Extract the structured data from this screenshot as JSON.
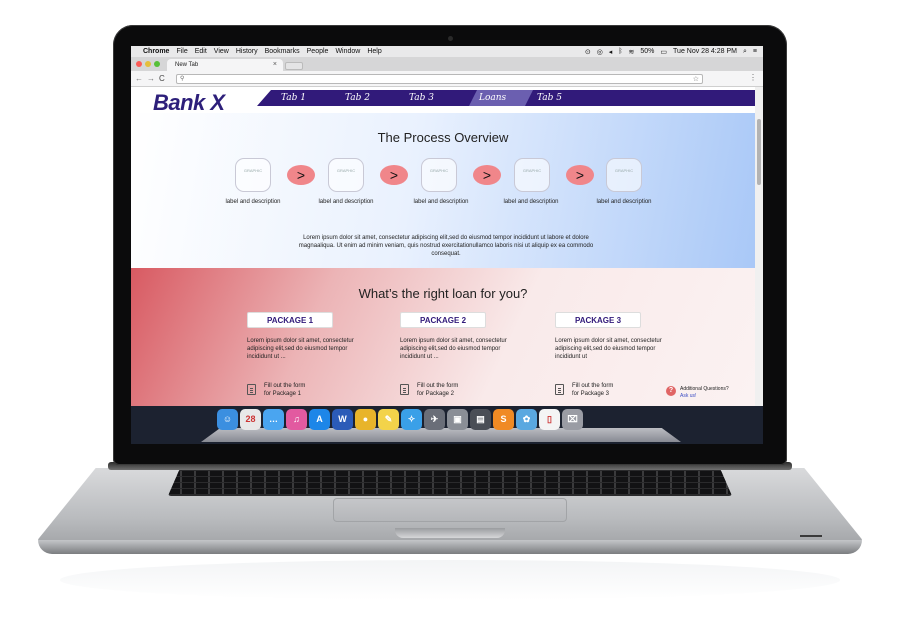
{
  "menubar": {
    "app": "Chrome",
    "items": [
      "File",
      "Edit",
      "View",
      "History",
      "Bookmarks",
      "People",
      "Window",
      "Help"
    ],
    "battery": "50%",
    "clock": "Tue Nov 28  4:28 PM"
  },
  "browser": {
    "tab_title": "New Tab",
    "tab_close": "×",
    "address_value": ""
  },
  "site": {
    "logo": "Bank X",
    "nav": [
      {
        "label": "Tab 1",
        "active": false
      },
      {
        "label": "Tab 2",
        "active": false
      },
      {
        "label": "Tab 3",
        "active": false
      },
      {
        "label": "Loans",
        "active": true
      },
      {
        "label": "Tab 5",
        "active": false
      }
    ],
    "process": {
      "title": "The Process Overview",
      "graphic_label": "GRAPHIC",
      "arrow": ">",
      "steps": [
        "label and description",
        "label and description",
        "label and description",
        "label and description",
        "label and description"
      ],
      "body": "Lorem ipsum dolor sit amet, consectetur adipiscing elit,sed do eiusmod tempor incididunt ut labore et dolore magnaaliqua. Ut enim ad minim veniam, quis nostrud exercitationullamco laboris nisi ut aliquip ex ea commodo consequat."
    },
    "loans": {
      "title": "What’s the right loan for you?",
      "packages": [
        {
          "label": "PACKAGE 1",
          "text": "Lorem ipsum dolor sit amet, consectetur adipiscing elit,sed do eiusmod tempor incididunt ut ...",
          "form_line1": "Fill out the form",
          "form_line2": "for Package 1"
        },
        {
          "label": "PACKAGE 2",
          "text": "Lorem ipsum dolor sit amet, consectetur adipiscing elit,sed do eiusmod tempor incididunt ut ...",
          "form_line1": "Fill out the form",
          "form_line2": "for Package 2"
        },
        {
          "label": "PACKAGE 3",
          "text": "Lorem ipsum dolor sit amet, consectetur adipiscing elit,sed do eiusmod tempor incididunt ut",
          "form_line1": "Fill out the form",
          "form_line2": "for Package 3"
        }
      ],
      "ask_title": "Additional Questions?",
      "ask_link": "Ask us!"
    }
  },
  "dock": {
    "apps": [
      {
        "name": "finder-icon",
        "glyph": "☺",
        "color": "#3b8fe0"
      },
      {
        "name": "calendar-icon",
        "glyph": "28",
        "color": "#e8e8e8"
      },
      {
        "name": "messages-icon",
        "glyph": "…",
        "color": "#4aa5f0"
      },
      {
        "name": "itunes-icon",
        "glyph": "♫",
        "color": "#e25aa0"
      },
      {
        "name": "app-store-icon",
        "glyph": "A",
        "color": "#1d86e8"
      },
      {
        "name": "word-icon",
        "glyph": "W",
        "color": "#2b5bb8"
      },
      {
        "name": "chrome-icon",
        "glyph": "●",
        "color": "#e8b42a"
      },
      {
        "name": "stickies-icon",
        "glyph": "✎",
        "color": "#f3d34a"
      },
      {
        "name": "safari-icon",
        "glyph": "✧",
        "color": "#3aa0e8"
      },
      {
        "name": "launchpad-icon",
        "glyph": "✈",
        "color": "#6a6e78"
      },
      {
        "name": "photo-icon",
        "glyph": "▣",
        "color": "#8a8e96"
      },
      {
        "name": "activity-icon",
        "glyph": "▤",
        "color": "#4a4e56"
      },
      {
        "name": "sublime-icon",
        "glyph": "S",
        "color": "#f08a24"
      },
      {
        "name": "preview-icon",
        "glyph": "✿",
        "color": "#5aa8e0"
      },
      {
        "name": "document-icon",
        "glyph": "▯",
        "color": "#f4f4f4"
      },
      {
        "name": "trash-icon",
        "glyph": "⌧",
        "color": "#9a9ca4"
      }
    ]
  }
}
